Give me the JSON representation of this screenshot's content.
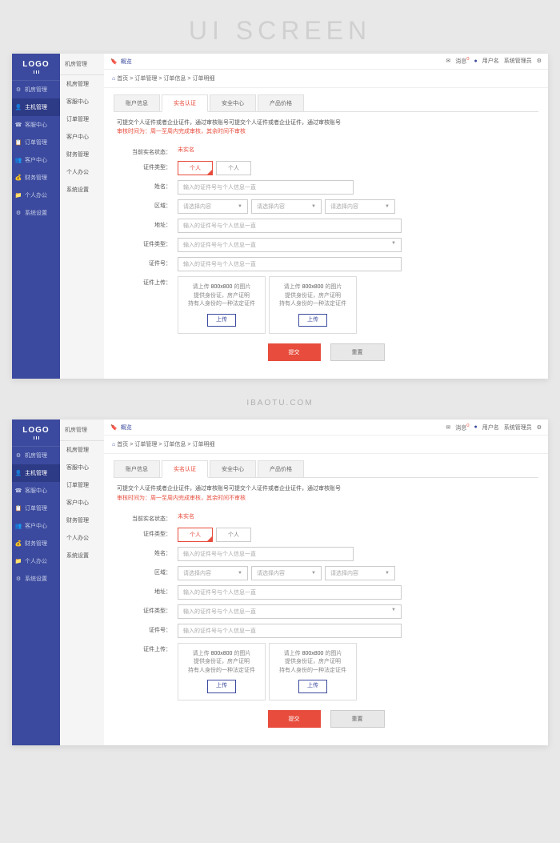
{
  "page_header": "UI SCREEN",
  "footer_url": "IBAOTU.COM",
  "logo": "LOGO",
  "topbar": {
    "overview": "概览",
    "msg_label": "消息",
    "msg_count": "0",
    "user": "用户名",
    "admin": "系统管理员"
  },
  "sidebar_primary": [
    {
      "icon": "⚙",
      "label": "机房管理"
    },
    {
      "icon": "👤",
      "label": "主机管理",
      "active": true
    },
    {
      "icon": "☎",
      "label": "客服中心"
    },
    {
      "icon": "📋",
      "label": "订单管理"
    },
    {
      "icon": "👥",
      "label": "客户中心"
    },
    {
      "icon": "💰",
      "label": "财务管理"
    },
    {
      "icon": "📁",
      "label": "个人办公"
    },
    {
      "icon": "⚙",
      "label": "系统设置"
    }
  ],
  "sidebar_secondary": {
    "header": "机房管理",
    "items": [
      "机房管理",
      "客服中心",
      "订单管理",
      "客户中心",
      "财务管理",
      "个人办公",
      "系统设置"
    ]
  },
  "breadcrumb": [
    "首页",
    "订单管理",
    "订单信息",
    "订单明细"
  ],
  "tabs": [
    {
      "label": "账户信息"
    },
    {
      "label": "实名认证",
      "active": true
    },
    {
      "label": "安全中心"
    },
    {
      "label": "产品价格"
    }
  ],
  "notice": {
    "line1": "可提交个人证件或者企业证件，通过审核账号可提交个人证件或者企业证件，通过审核账号",
    "line2_prefix": "审核时间为：",
    "line2_red": "周一至周内完成审核，其余时间不审核"
  },
  "form": {
    "status_label": "当前实名状态：",
    "status_value": "未实名",
    "cert_type_label": "证件类型：",
    "cert_type_opts": [
      "个人",
      "个人"
    ],
    "name_label": "姓名：",
    "name_placeholder": "输入的证件号与个人信息一直",
    "region_label": "区域：",
    "region_placeholder": "请选择内容",
    "address_label": "地址：",
    "address_placeholder": "输入的证件号与个人信息一直",
    "cert_kind_label": "证件类型：",
    "cert_kind_placeholder": "输入的证件号与个人信息一直",
    "cert_no_label": "证件号：",
    "cert_no_placeholder": "输入的证件号与个人信息一直",
    "upload_label": "证件上传：",
    "upload_hint1": "请上传",
    "upload_hint_size": "800x800",
    "upload_hint2": "的图片",
    "upload_hint3": "提供身份证，房产证明",
    "upload_hint4": "持有人身份的一种法定证件",
    "upload_btn": "上传",
    "submit": "提交",
    "reset": "重置"
  }
}
